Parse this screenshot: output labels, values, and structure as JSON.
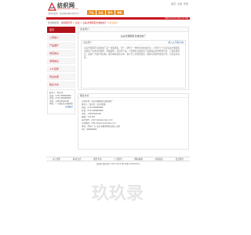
{
  "header": {
    "site_name": "纺织网",
    "site_url": "www.fzwmkt.com.cn",
    "slogan": "中国纺织网 · 纺织面料辅料采购平台",
    "toplinks": [
      "首页",
      "注册",
      "登录"
    ],
    "nav": [
      "产品",
      "企业",
      "资讯",
      "商机"
    ]
  },
  "red_bar": {
    "text": "Welcome to visit our site"
  },
  "breadcrumb": {
    "prefix": "您当前位置：",
    "path": "纺织网首页 > 企业 > 汕头市潮南区长发纺织厂 >",
    "current": "企业简介"
  },
  "sidebar": {
    "items": [
      "首页",
      "公司简介",
      "产品展厅",
      "供应信息",
      "求购信息",
      "人才招聘",
      "营业执照",
      "联系方式"
    ],
    "active_index": 0,
    "contact": {
      "lines": [
        "联系人：陈先生",
        "电话：0754-88888888",
        "传真：0754-88888888",
        "手机：13800000000",
        "地址：广东省汕头市潮南区"
      ],
      "map_link": "在线联系"
    }
  },
  "main": {
    "panel_head": "企业简介",
    "company_name": "汕头市潮南区长发纺织厂",
    "body_head": "企业简介",
    "more": "加入公司名片夹",
    "text": "汕头市潮南区长发纺织厂是一家集研发、生产、销售于一体的专业纺织企业，公司位于广东省汕头市潮南区，主要生产各类针织面料、经编面料、花边等产品。公司拥有先进的生产设备和完善的检测手段，产品质量稳定，深受广大客户的信赖。我们本着诚信为本、客户至上的经营理念，竭诚与国内外客商合作，共创美好未来。"
  },
  "detail": {
    "head": "联系方式",
    "lines": [
      "公司名称：汕头市潮南区长发纺织厂",
      "联系人：陈先生（业务经理）",
      "电话：0754-88888888",
      "传真：0754-88888888",
      "手机：13800000000",
      "邮编：515144",
      "电子邮件：admin@example.com",
      "公司网站：http://www.example.com",
      "地址：中国 广东 汕头市潮南区陈店镇工业区",
      "QQ：88888888"
    ]
  },
  "footer": {
    "links": [
      "关于我们",
      "联系方式",
      "服务条款",
      "广告服务",
      "网站地图",
      "友情链接",
      "会员服务"
    ],
    "copyright": "纺织网 版权所有 1997-2019 粤ICP备12345678号"
  },
  "watermark": {
    "text": "玖玖录"
  },
  "colors": {
    "accent": "#c8171e",
    "nav": "#e58a1d",
    "link": "#3366aa"
  }
}
